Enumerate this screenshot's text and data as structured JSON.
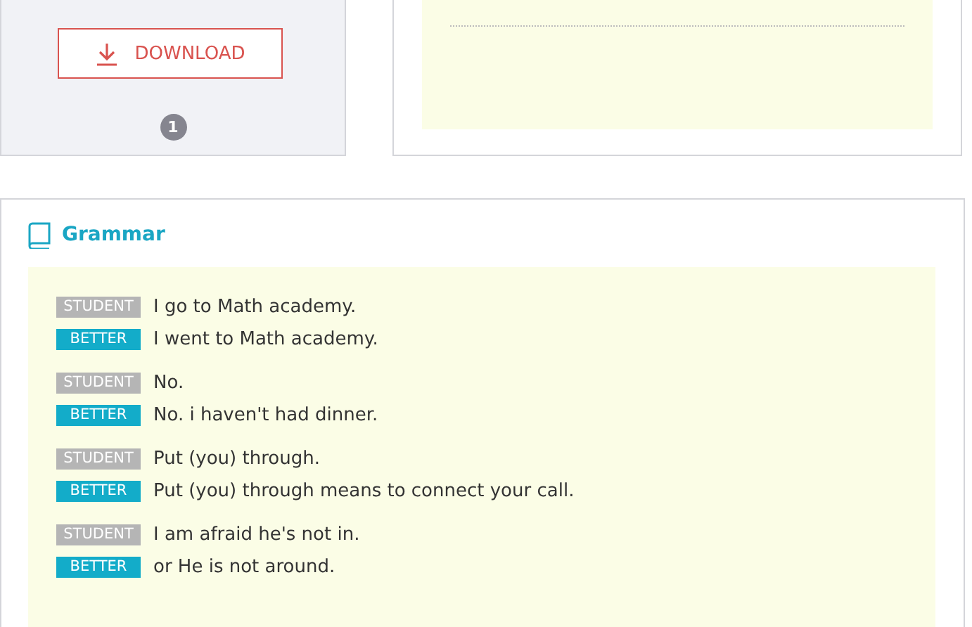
{
  "download_panel": {
    "button": "DOWNLOAD",
    "page_badge": "1"
  },
  "grammar": {
    "title": "Grammar",
    "groups": [
      {
        "lines": [
          {
            "kind": "student",
            "tag": "STUDENT",
            "text": "I go to Math academy."
          },
          {
            "kind": "better",
            "tag": "BETTER",
            "text": "I went to Math academy."
          }
        ]
      },
      {
        "lines": [
          {
            "kind": "student",
            "tag": "STUDENT",
            "text": "No."
          },
          {
            "kind": "better",
            "tag": "BETTER",
            "text": "No. i haven't had dinner."
          }
        ]
      },
      {
        "lines": [
          {
            "kind": "student",
            "tag": "STUDENT",
            "text": "Put (you) through."
          },
          {
            "kind": "better",
            "tag": "BETTER",
            "text": "Put (you) through means to connect your call."
          }
        ]
      },
      {
        "lines": [
          {
            "kind": "student",
            "tag": "STUDENT",
            "text": "I am afraid he's not in."
          },
          {
            "kind": "better",
            "tag": "BETTER",
            "text": "or He is not around."
          }
        ]
      }
    ]
  }
}
